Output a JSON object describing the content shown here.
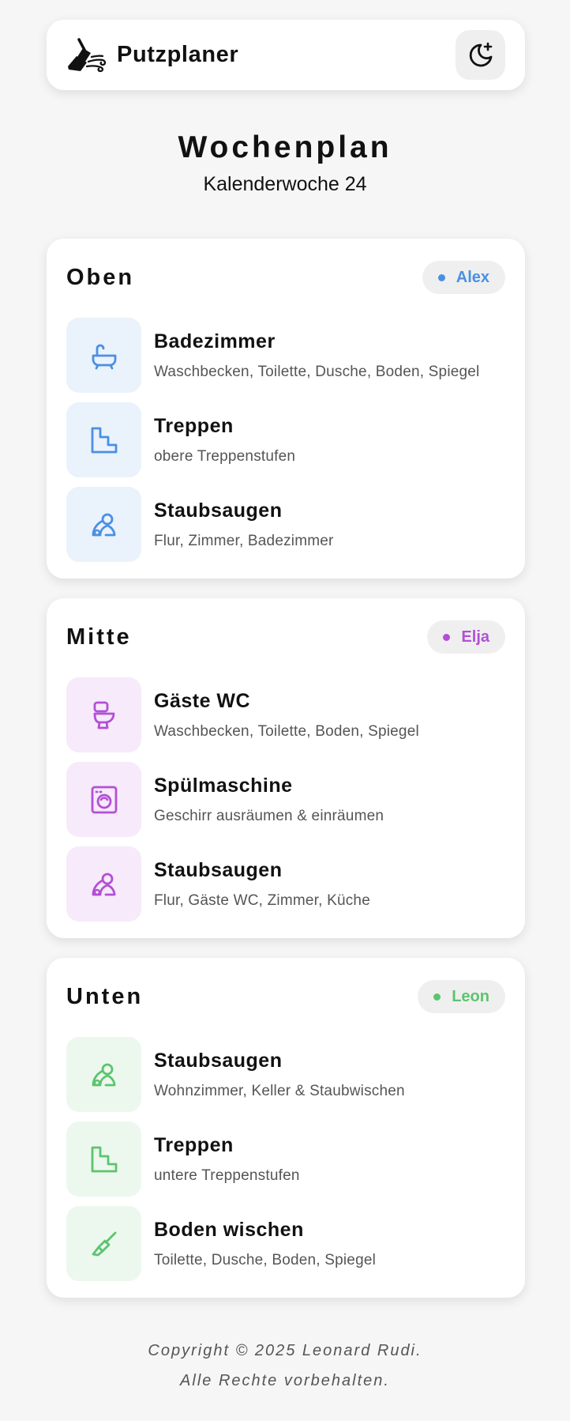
{
  "app": {
    "name": "Putzplaner",
    "logo_icon": "broom-icon",
    "theme_toggle_icon": "moon-stars-icon"
  },
  "page": {
    "title": "Wochenplan",
    "subtitle": "Kalenderwoche 24"
  },
  "sections": [
    {
      "floor": "Oben",
      "person": "Alex",
      "accent": "#4a90e2",
      "tint": "#eaf2fc",
      "tasks": [
        {
          "icon": "bathtub-icon",
          "title": "Badezimmer",
          "desc": "Waschbecken, Toilette, Dusche, Boden, Spiegel"
        },
        {
          "icon": "stairs-icon",
          "title": "Treppen",
          "desc": "obere Treppenstufen"
        },
        {
          "icon": "vacuum-icon",
          "title": "Staubsaugen",
          "desc": "Flur, Zimmer, Badezimmer"
        }
      ]
    },
    {
      "floor": "Mitte",
      "person": "Elja",
      "accent": "#b34fd6",
      "tint": "#f6eafb",
      "tasks": [
        {
          "icon": "toilet-icon",
          "title": "Gäste WC",
          "desc": "Waschbecken, Toilette, Boden, Spiegel"
        },
        {
          "icon": "dishwasher-icon",
          "title": "Spülmaschine",
          "desc": "Geschirr ausräumen & einräumen"
        },
        {
          "icon": "vacuum-icon",
          "title": "Staubsaugen",
          "desc": "Flur, Gäste WC, Zimmer, Küche"
        }
      ]
    },
    {
      "floor": "Unten",
      "person": "Leon",
      "accent": "#5cc46f",
      "tint": "#ecf8ee",
      "tasks": [
        {
          "icon": "vacuum-icon",
          "title": "Staubsaugen",
          "desc": "Wohnzimmer, Keller & Staubwischen"
        },
        {
          "icon": "stairs-icon",
          "title": "Treppen",
          "desc": "untere Treppenstufen"
        },
        {
          "icon": "brush-icon",
          "title": "Boden wischen",
          "desc": "Toilette, Dusche, Boden, Spiegel"
        }
      ]
    }
  ],
  "footer": {
    "line1": "Copyright © 2025 Leonard Rudi.",
    "line2": "Alle Rechte vorbehalten."
  }
}
